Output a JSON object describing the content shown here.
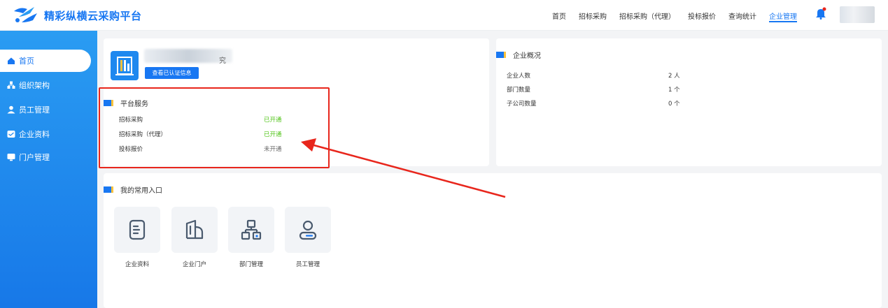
{
  "app": {
    "title": "精彩纵横云采购平台"
  },
  "nav": [
    "首页",
    "招标采购",
    "招标采购（代理）",
    "投标报价",
    "查询统计",
    "企业管理"
  ],
  "nav_active": "企业管理",
  "sidebar": [
    "首页",
    "组织架构",
    "员工管理",
    "企业资料",
    "门户管理"
  ],
  "sidebar_active": "首页",
  "enterprise": {
    "name_tail": "究",
    "verify_button": "查看已认证信息"
  },
  "platform_services": {
    "title": "平台服务",
    "rows": [
      {
        "label": "招标采购",
        "status": "已开通"
      },
      {
        "label": "招标采购（代理）",
        "status": "已开通"
      },
      {
        "label": "投标报价",
        "status": "未开通"
      }
    ]
  },
  "overview": {
    "title": "企业概况",
    "rows": [
      {
        "label": "企业人数",
        "value": "2 人"
      },
      {
        "label": "部门数量",
        "value": "1 个"
      },
      {
        "label": "子公司数量",
        "value": "0 个"
      }
    ]
  },
  "quick_entry": {
    "title": "我的常用入口",
    "items": [
      {
        "label": "企业资料",
        "icon": "document-icon"
      },
      {
        "label": "企业门户",
        "icon": "building-icon"
      },
      {
        "label": "部门管理",
        "icon": "org-tree-icon"
      },
      {
        "label": "员工管理",
        "icon": "user-icon"
      }
    ]
  },
  "colors": {
    "brand": "#1877f2",
    "sidebar": "#1e88ef",
    "enabled": "#52c41a",
    "annotation": "#e8261c"
  }
}
